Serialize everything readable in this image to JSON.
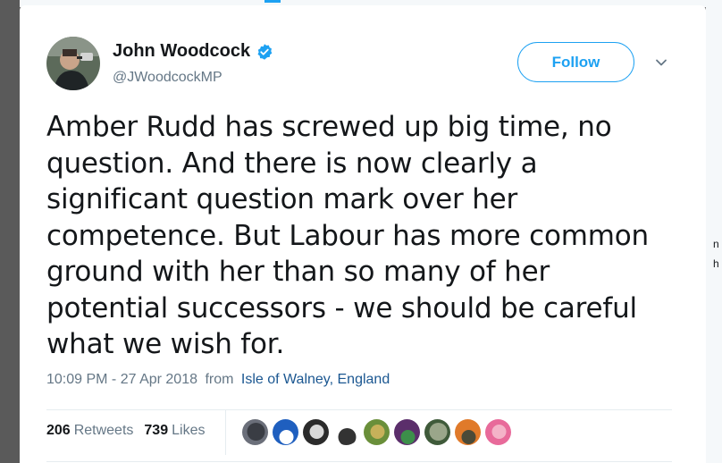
{
  "user": {
    "name": "John Woodcock",
    "handle": "@JWoodcockMP",
    "verified": true,
    "avatar_icon": "profile-photo"
  },
  "actions": {
    "follow_label": "Follow",
    "more_icon": "chevron-down-icon"
  },
  "tweet": {
    "lines": [
      "Amber Rudd has screwed up big time, no",
      "question. And there is now clearly a",
      "significant question mark over her",
      "competence. But Labour has more common",
      "ground with her than so many of her",
      "potential successors - we should be careful",
      "what we wish for."
    ],
    "timestamp": "10:09 PM - 27 Apr 2018",
    "from_word": "from",
    "location": "Isle of Walney, England"
  },
  "stats": {
    "retweets_count": "206",
    "retweets_label": "Retweets",
    "likes_count": "739",
    "likes_label": "Likes"
  },
  "likers": [
    {
      "name": "liker-avatar-1",
      "colors": [
        "#6b6f7a",
        "#3a3d44"
      ]
    },
    {
      "name": "liker-avatar-2",
      "colors": [
        "#1f5fbf",
        "#ffffff"
      ]
    },
    {
      "name": "liker-avatar-3",
      "colors": [
        "#2b2b2b",
        "#d9d9d9"
      ]
    },
    {
      "name": "liker-avatar-4",
      "colors": [
        "#ffffff",
        "#333333"
      ]
    },
    {
      "name": "liker-avatar-5",
      "colors": [
        "#6a8f3a",
        "#c7b15a"
      ]
    },
    {
      "name": "liker-avatar-6",
      "colors": [
        "#5b2e6b",
        "#3c8f4a"
      ]
    },
    {
      "name": "liker-avatar-7",
      "colors": [
        "#3f5a3a",
        "#9aa68a"
      ]
    },
    {
      "name": "liker-avatar-8",
      "colors": [
        "#e07a2a",
        "#4a4a38"
      ]
    },
    {
      "name": "liker-avatar-9",
      "colors": [
        "#e86a9a",
        "#f4b3c8"
      ]
    }
  ],
  "colors": {
    "accent": "#1da1f2",
    "text": "#14171a",
    "muted": "#657786",
    "link": "#1b5791"
  }
}
